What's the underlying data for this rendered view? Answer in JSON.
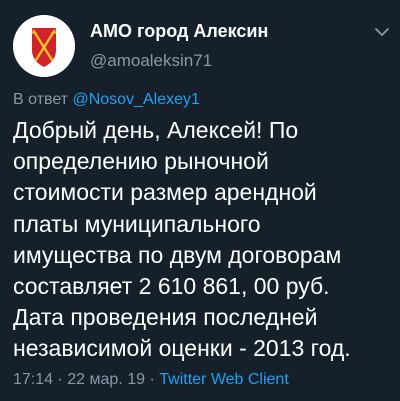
{
  "author": {
    "name": "АМО город Алексин",
    "handle": "@amoaleksin71",
    "avatar_icon": "coat-of-arms-icon"
  },
  "reply": {
    "prefix": "В ответ",
    "mention": "@Nosov_Alexey1"
  },
  "tweet": {
    "text": "Добрый день, Алексей! По\nопределению рыночной\nстоимости размер арендной\nплаты муниципального\nимущества по двум договорам\nсоставляет 2 610 861, 00 руб.\nДата проведения последней\nнезависимой оценки - 2013 год."
  },
  "meta": {
    "time": "17:14",
    "separator": "·",
    "date": "22 мар. 19",
    "client": "Twitter Web Client"
  },
  "colors": {
    "background": "#15202b",
    "text": "#ffffff",
    "secondary": "#8899a6",
    "link": "#1da1f2",
    "shield_red": "#d2232a",
    "shield_gold": "#f2c12e"
  }
}
